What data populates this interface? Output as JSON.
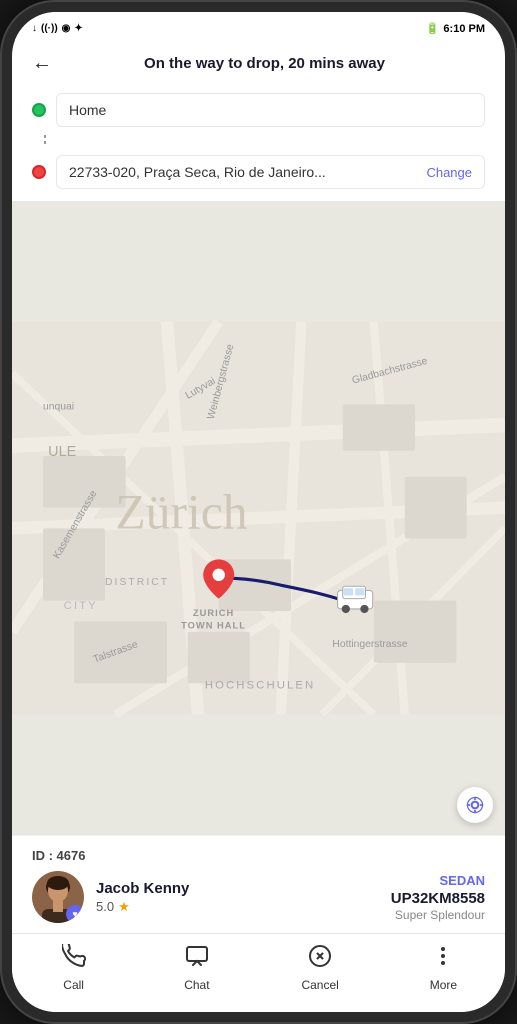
{
  "statusBar": {
    "time": "6:10 PM",
    "batteryIcon": "🔋",
    "signalIcons": [
      "↓",
      "((·))",
      "◉",
      "✦"
    ]
  },
  "header": {
    "backLabel": "←",
    "title": "On the way to drop, 20 mins away"
  },
  "route": {
    "origin": "Home",
    "destination": "22733-020, Praça Seca, Rio de Janeiro...",
    "changeLabel": "Change"
  },
  "driver": {
    "idLabel": "ID : 4676",
    "name": "Jacob Kenny",
    "rating": "5.0",
    "vehicleType": "SEDAN",
    "vehiclePlate": "UP32KM8558",
    "vehicleModel": "Super Splendour"
  },
  "tabBar": {
    "items": [
      {
        "id": "call",
        "label": "Call",
        "icon": "☎"
      },
      {
        "id": "chat",
        "label": "Chat",
        "icon": "💬"
      },
      {
        "id": "cancel",
        "label": "Cancel",
        "icon": "⊗"
      },
      {
        "id": "more",
        "label": "More",
        "icon": "⋮"
      }
    ]
  },
  "map": {
    "city": "Z ü r i c h",
    "district": "DISTRICT",
    "city2": "CITY",
    "townHall": "ZURICH\nTOWN HALL",
    "hochschulen": "HOCHSCHULEN"
  }
}
